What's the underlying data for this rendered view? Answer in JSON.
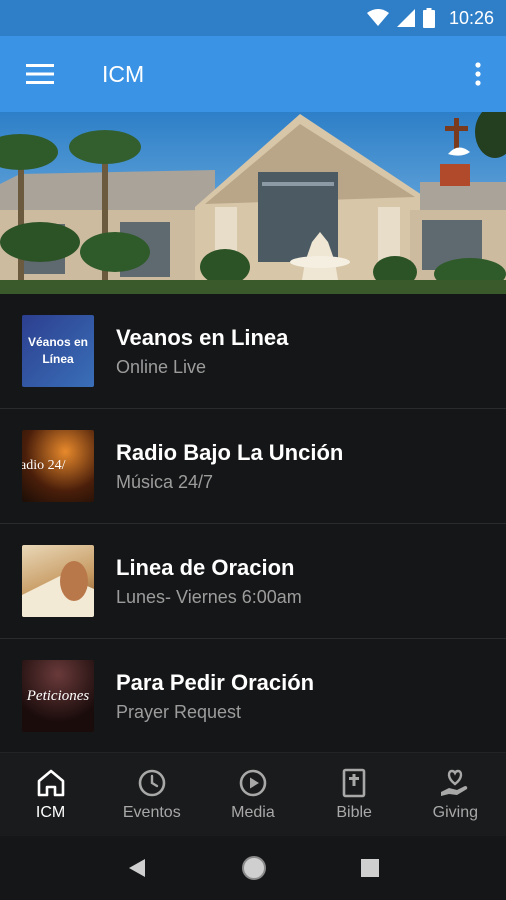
{
  "status_bar": {
    "time": "10:26",
    "icons": [
      "wifi-icon",
      "signal-icon",
      "battery-icon"
    ]
  },
  "app_bar": {
    "title": "ICM",
    "menu_icon": "hamburger-menu-icon",
    "overflow_icon": "more-vert-icon"
  },
  "list": {
    "items": [
      {
        "title": "Veanos en Linea",
        "subtitle": "Online Live",
        "thumb_text": "Véanos en Línea"
      },
      {
        "title": "Radio Bajo La Unción",
        "subtitle": "Música 24/7",
        "thumb_text": "adio 24/"
      },
      {
        "title": "Linea de Oracion",
        "subtitle": "Lunes- Viernes 6:00am",
        "thumb_text": ""
      },
      {
        "title": "Para Pedir Oración",
        "subtitle": "Prayer Request",
        "thumb_text": "Peticiones"
      }
    ]
  },
  "bottom_nav": {
    "items": [
      {
        "label": "ICM",
        "icon": "home-icon",
        "active": true
      },
      {
        "label": "Eventos",
        "icon": "clock-icon",
        "active": false
      },
      {
        "label": "Media",
        "icon": "play-circle-icon",
        "active": false
      },
      {
        "label": "Bible",
        "icon": "bible-icon",
        "active": false
      },
      {
        "label": "Giving",
        "icon": "giving-heart-hand-icon",
        "active": false
      }
    ]
  },
  "colors": {
    "status_bar": "#2f7fc8",
    "app_bar": "#3a93e4",
    "background": "#151617",
    "nav_background": "#1a1b1c"
  }
}
